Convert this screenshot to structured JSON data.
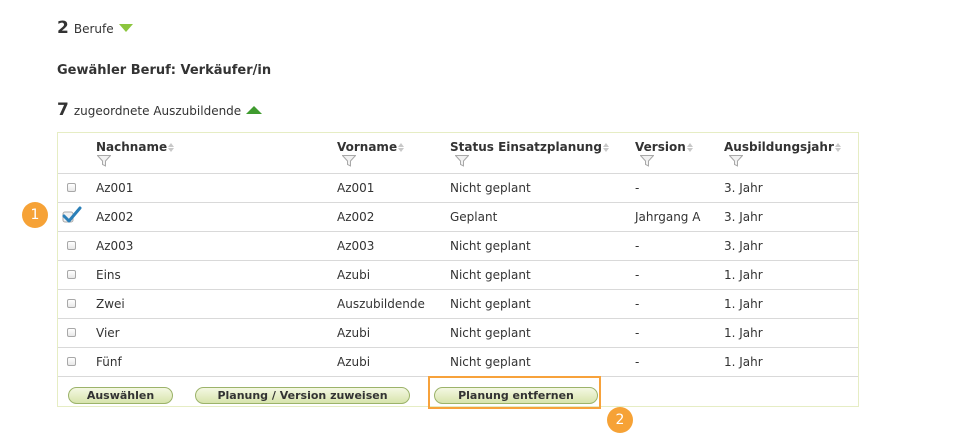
{
  "berufe": {
    "count": "2",
    "label": "Berufe",
    "toggle_icon": "triangle-down-icon"
  },
  "selected": {
    "text": "Gewähler Beruf: Verkäufer/in"
  },
  "azubis": {
    "count": "7",
    "label": "zugeordnete Auszubildende",
    "toggle_icon": "triangle-up-icon"
  },
  "table": {
    "columns": [
      "Nachname",
      "Vorname",
      "Status Einsatzplanung",
      "Version",
      "Ausbildungsjahr"
    ],
    "rows": [
      {
        "nachname": "Az001",
        "vorname": "Az001",
        "status": "Nicht geplant",
        "version": "-",
        "jahr": "3. Jahr",
        "checked": false
      },
      {
        "nachname": "Az002",
        "vorname": "Az002",
        "status": "Geplant",
        "version": "Jahrgang A",
        "jahr": "3. Jahr",
        "checked": true
      },
      {
        "nachname": "Az003",
        "vorname": "Az003",
        "status": "Nicht geplant",
        "version": "-",
        "jahr": "3. Jahr",
        "checked": false
      },
      {
        "nachname": "Eins",
        "vorname": "Azubi",
        "status": "Nicht geplant",
        "version": "-",
        "jahr": "1. Jahr",
        "checked": false
      },
      {
        "nachname": "Zwei",
        "vorname": "Auszubildende",
        "status": "Nicht geplant",
        "version": "-",
        "jahr": "1. Jahr",
        "checked": false
      },
      {
        "nachname": "Vier",
        "vorname": "Azubi",
        "status": "Nicht geplant",
        "version": "-",
        "jahr": "1. Jahr",
        "checked": false
      },
      {
        "nachname": "Fünf",
        "vorname": "Azubi",
        "status": "Nicht geplant",
        "version": "-",
        "jahr": "1. Jahr",
        "checked": false
      }
    ]
  },
  "buttons": {
    "select": "Auswählen",
    "assign": "Planung / Version zuweisen",
    "remove": "Planung entfernen"
  },
  "markers": {
    "first": "1",
    "second": "2"
  },
  "colors": {
    "accent_green": "#8cc63e",
    "highlight_orange": "#f7a23b",
    "check_blue": "#2a7fb8"
  }
}
